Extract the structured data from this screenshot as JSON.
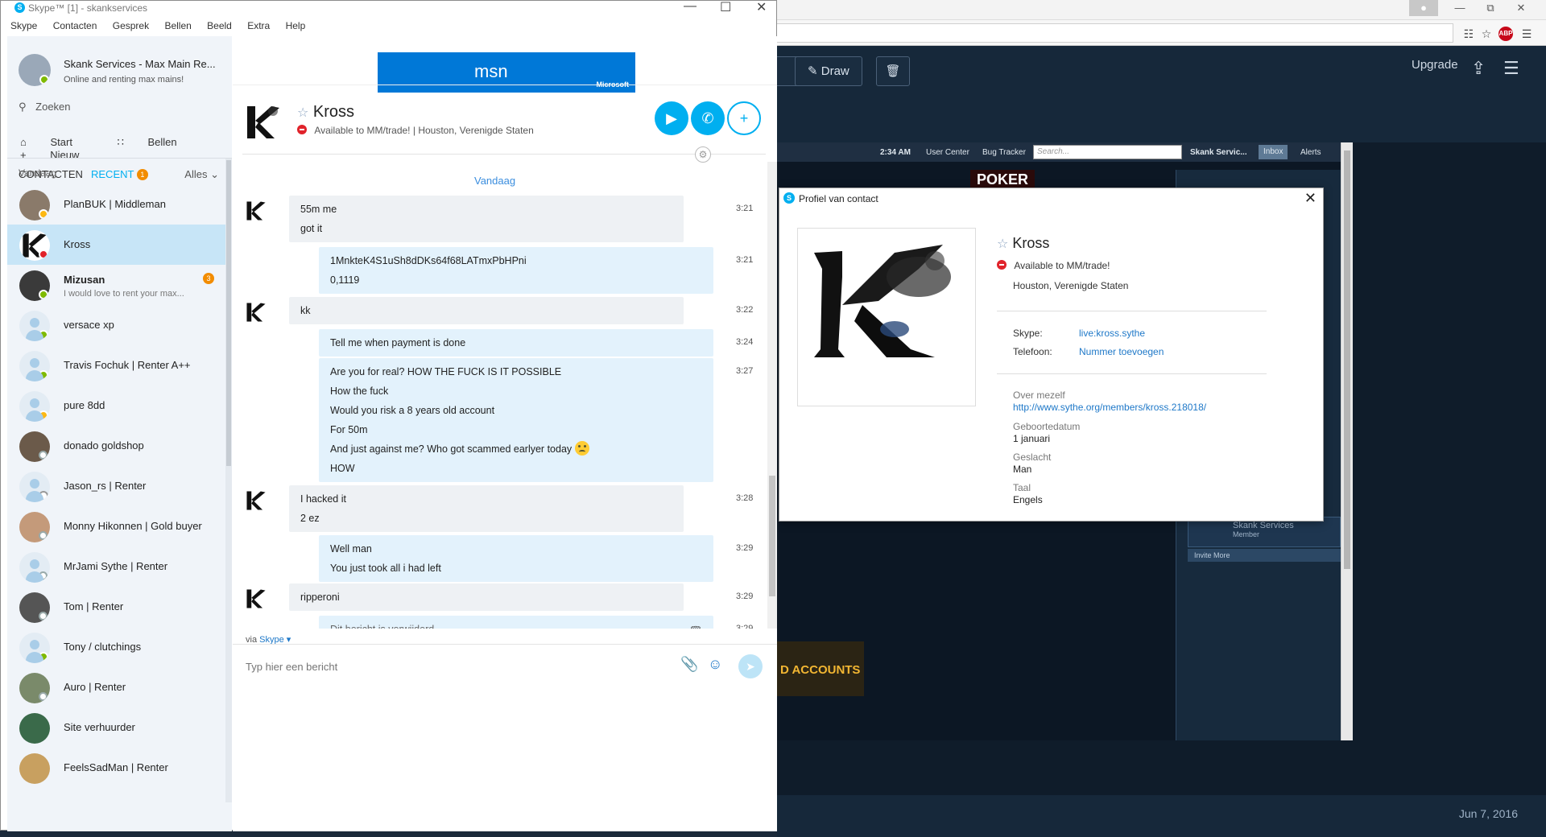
{
  "skype": {
    "title": "Skype™ [1] - skankservices",
    "menu": [
      "Skype",
      "Contacten",
      "Gesprek",
      "Bellen",
      "Beeld",
      "Extra",
      "Help"
    ],
    "me": {
      "name": "Skank Services - Max Main Re...",
      "mood": "Online and renting max mains!"
    },
    "search_placeholder": "Zoeken",
    "nav": {
      "start": "Start",
      "call": "Bellen",
      "new": "Nieuw"
    },
    "tabs": {
      "contacts": "CONTACTEN",
      "recent": "RECENT",
      "recent_badge": "1",
      "filter": "Alles"
    },
    "today_label": "Vandaag",
    "contacts": [
      {
        "name": "PlanBUK | Middleman",
        "status": "away",
        "avatar": "photo"
      },
      {
        "name": "Kross",
        "status": "dnd",
        "avatar": "kross",
        "active": true
      },
      {
        "name": "Mizusan",
        "sub": "I would love to rent your max...",
        "status": "online",
        "avatar": "photo",
        "bold": true,
        "badge": "3"
      },
      {
        "name": "versace xp",
        "status": "online",
        "avatar": "generic"
      },
      {
        "name": "Travis Fochuk | Renter A++",
        "status": "online",
        "avatar": "generic"
      },
      {
        "name": "pure 8dd",
        "status": "away",
        "avatar": "generic"
      },
      {
        "name": "donado goldshop",
        "status": "offline",
        "avatar": "photo"
      },
      {
        "name": "Jason_rs | Renter",
        "status": "unknown",
        "avatar": "generic"
      },
      {
        "name": "Monny Hikonnen | Gold buyer",
        "status": "offline",
        "avatar": "photo"
      },
      {
        "name": "MrJami Sythe | Renter",
        "status": "offline",
        "avatar": "generic"
      },
      {
        "name": "Tom | Renter",
        "status": "offline",
        "avatar": "photo"
      },
      {
        "name": "Tony / clutchings",
        "status": "online",
        "avatar": "generic"
      },
      {
        "name": "Auro | Renter",
        "status": "offline",
        "avatar": "photo"
      },
      {
        "name": "Site verhuurder",
        "status": "",
        "avatar": "photo"
      },
      {
        "name": "FeelsSadMan | Renter",
        "status": "",
        "avatar": "photo"
      }
    ]
  },
  "ad": {
    "brand": "msn",
    "vendor": "Microsoft"
  },
  "chat": {
    "name": "Kross",
    "mood": "Available to MM/trade!",
    "location": "Houston, Verenigde Staten",
    "day_label": "Vandaag",
    "messages": [
      {
        "dir": "in",
        "lines": [
          "55m me",
          "got it"
        ],
        "time": "3:21"
      },
      {
        "dir": "out",
        "lines": [
          "1MnkteK4S1uSh8dDKs64f68LATmxPbHPni",
          "0,1119"
        ],
        "time": "3:21"
      },
      {
        "dir": "in",
        "lines": [
          "kk"
        ],
        "time": "3:22"
      },
      {
        "dir": "out",
        "lines": [
          "Tell me when payment is done"
        ],
        "time": "3:24"
      },
      {
        "dir": "out",
        "lines": [
          "Are you for real? HOW THE FUCK IS IT POSSIBLE",
          "How the fuck",
          "Would you risk a 8 years old account",
          "For 50m",
          "And just against me? Who got scammed earlyer today",
          "HOW"
        ],
        "time": "3:27",
        "emoji_line": 4
      },
      {
        "dir": "in",
        "lines": [
          "I hacked it",
          "2 ez"
        ],
        "time": "3:28"
      },
      {
        "dir": "out",
        "lines": [
          "Well man",
          "You just took all i had left"
        ],
        "time": "3:29"
      },
      {
        "dir": "in",
        "lines": [
          "ripperoni"
        ],
        "time": "3:29"
      },
      {
        "dir": "out",
        "lines": [
          "Dit bericht is verwijderd."
        ],
        "time": "3:29",
        "deleted": true
      }
    ],
    "via": "via",
    "via_link": "Skype",
    "compose_placeholder": "Typ hier een bericht"
  },
  "profile": {
    "title": "Profiel van contact",
    "name": "Kross",
    "mood": "Available to MM/trade!",
    "location": "Houston, Verenigde Staten",
    "skype_label": "Skype:",
    "skype_value": "live:kross.sythe",
    "phone_label": "Telefoon:",
    "phone_value": "Nummer toevoegen",
    "about_label": "Over mezelf",
    "about_value": "http://www.sythe.org/members/kross.218018/",
    "birthday_label": "Geboortedatum",
    "birthday_value": "1 januari",
    "gender_label": "Geslacht",
    "gender_value": "Man",
    "language_label": "Taal",
    "language_value": "Engels"
  },
  "browser": {
    "draw_label": "Draw",
    "upgrade_label": "Upgrade",
    "date": "Jun 7, 2016",
    "sythe": {
      "time": "2:34 AM",
      "user_center": "User Center",
      "bug_tracker": "Bug Tracker",
      "search_placeholder": "Search...",
      "account": "Skank Servic...",
      "inbox": "Inbox",
      "alerts": "Alerts",
      "poker": "POKER",
      "member_name": "Skank Services",
      "member_role": "Member",
      "invite": "Invite More",
      "accounts_banner": "D ACCOUNTS"
    }
  },
  "colors": {
    "skype_blue": "#00aff0",
    "online": "#7fba00",
    "away": "#fdb813",
    "dnd": "#e0232b"
  }
}
